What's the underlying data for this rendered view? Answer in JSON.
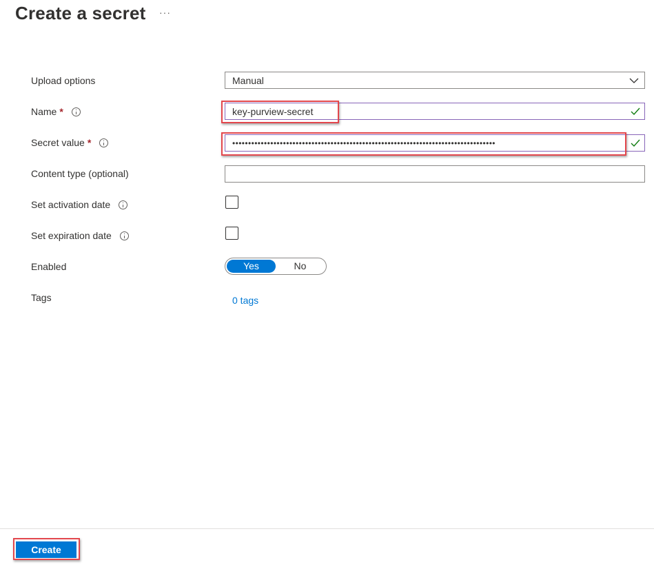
{
  "header": {
    "title": "Create a secret",
    "more_icon": "ellipsis-icon",
    "more_label": "···"
  },
  "form": {
    "upload_options": {
      "label": "Upload options",
      "value": "Manual"
    },
    "name": {
      "label": "Name",
      "required_mark": "*",
      "value": "key-purview-secret",
      "status": "valid"
    },
    "secret_value": {
      "label": "Secret value",
      "required_mark": "*",
      "masked_value": "•••••••••••••••••••••••••••••••••••••••••••••••••••••••••••••••••••••••••••••••••••",
      "status": "valid"
    },
    "content_type": {
      "label": "Content type (optional)",
      "value": ""
    },
    "activation_date": {
      "label": "Set activation date",
      "checked": false
    },
    "expiration_date": {
      "label": "Set expiration date",
      "checked": false
    },
    "enabled": {
      "label": "Enabled",
      "options": [
        "Yes",
        "No"
      ],
      "selected": "Yes"
    },
    "tags": {
      "label": "Tags",
      "link_text": "0 tags"
    }
  },
  "footer": {
    "create_label": "Create"
  },
  "colors": {
    "accent": "#0078d4",
    "valid_check": "#107c10",
    "required": "#a4262c",
    "highlight": "#e3464c"
  }
}
